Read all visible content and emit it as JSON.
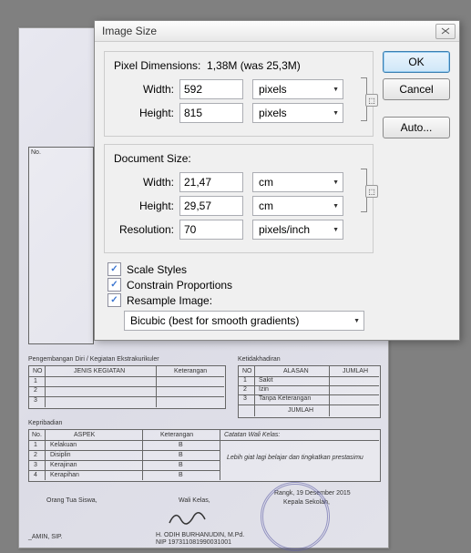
{
  "dialog": {
    "title": "Image Size",
    "pixel_dim_label": "Pixel Dimensions:",
    "pixel_dim_size": "1,38M (was 25,3M)",
    "width_label": "Width:",
    "height_label": "Height:",
    "px_width": "592",
    "px_height": "815",
    "px_unit": "pixels",
    "doc_size_label": "Document Size:",
    "doc_width": "21,47",
    "doc_height": "29,57",
    "doc_unit": "cm",
    "resolution_label": "Resolution:",
    "resolution": "70",
    "resolution_unit": "pixels/inch",
    "scale_styles": "Scale Styles",
    "constrain": "Constrain Proportions",
    "resample": "Resample Image:",
    "resample_method": "Bicubic (best for smooth gradients)"
  },
  "buttons": {
    "ok": "OK",
    "cancel": "Cancel",
    "auto": "Auto..."
  },
  "bg": {
    "h1": "Pengembangan Diri / Kegiatan Ekstrakurikuler",
    "col1": "JENIS KEGIATAN",
    "col2": "Keterangan",
    "h2": "Ketidakhadiran",
    "c1": "ALASAN",
    "c2": "JUMLAH",
    "r1": "Sakit",
    "r2": "Izin",
    "r3": "Tanpa Keterangan",
    "rsum": "JUMLAH",
    "h3": "Kepribadian",
    "aspek": "ASPEK",
    "ket": "Keterangan",
    "cat": "Catatan Wali Kelas:",
    "a1": "Kelakuan",
    "a2": "Disiplin",
    "a3": "Kerajinan",
    "a4": "Kerapihan",
    "b": "B",
    "note": "Lebih giat lagi belajar dan tingkatkan prestasimu",
    "sig1": "Orang Tua Siswa,",
    "sig2": "Wali Kelas,",
    "date": "Rangk, 19 Desember 2015",
    "sig3": "Kepala Sekolah,",
    "name1": "_AMIN, SIP.",
    "name2": "H. ODIH BURHANUDIN, M.Pd.",
    "nip": "NIP 197311081990031001"
  }
}
